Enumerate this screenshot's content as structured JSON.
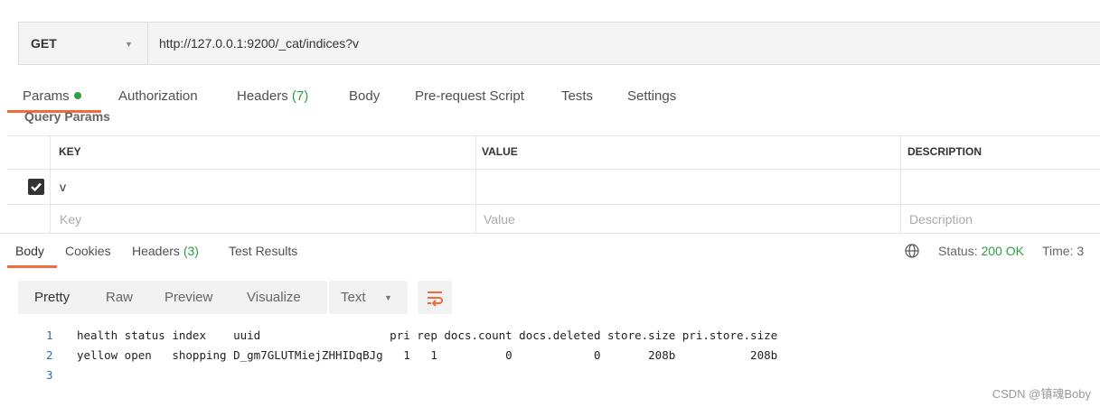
{
  "request": {
    "method": "GET",
    "url": "http://127.0.0.1:9200/_cat/indices?v"
  },
  "request_tabs": {
    "params": "Params",
    "authorization": "Authorization",
    "headers": "Headers",
    "headers_count": "(7)",
    "body": "Body",
    "prerequest": "Pre-request Script",
    "tests": "Tests",
    "settings": "Settings"
  },
  "query_params": {
    "title": "Query Params",
    "columns": {
      "key": "KEY",
      "value": "VALUE",
      "description": "DESCRIPTION"
    },
    "row": {
      "checked": true,
      "key": "v",
      "value": "",
      "description": ""
    },
    "placeholders": {
      "key": "Key",
      "value": "Value",
      "description": "Description"
    }
  },
  "response_tabs": {
    "body": "Body",
    "cookies": "Cookies",
    "headers": "Headers",
    "headers_count": "(3)",
    "test_results": "Test Results"
  },
  "status": {
    "label": "Status:",
    "value": "200 OK",
    "time_label": "Time: 3"
  },
  "view_modes": {
    "pretty": "Pretty",
    "raw": "Raw",
    "preview": "Preview",
    "visualize": "Visualize",
    "format": "Text"
  },
  "response_body": {
    "line_numbers": [
      "1",
      "2",
      "3"
    ],
    "lines": [
      "health status index    uuid                   pri rep docs.count docs.deleted store.size pri.store.size",
      "yellow open   shopping D_gm7GLUTMiejZHHIDqBJg   1   1          0            0       208b           208b",
      ""
    ]
  },
  "colors": {
    "accent": "#f26b3a",
    "success": "#2f9e44",
    "code_line_number": "#2a6db0"
  },
  "watermark": "CSDN @镇魂Boby"
}
